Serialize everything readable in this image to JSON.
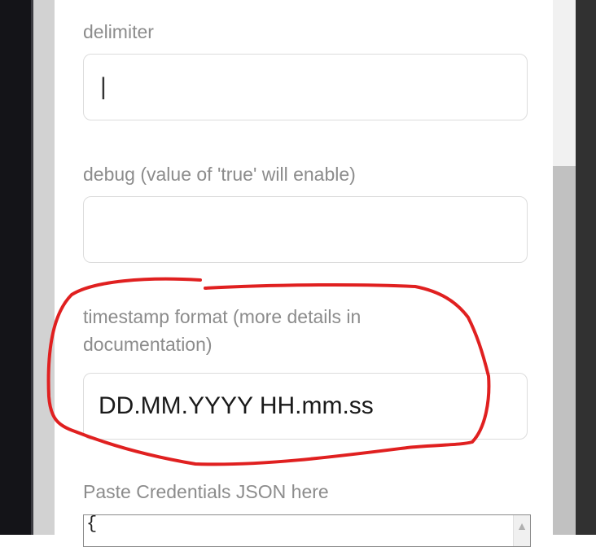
{
  "form": {
    "delimiter": {
      "label": "delimiter",
      "value": "|"
    },
    "debug": {
      "label": "debug (value of 'true' will enable)",
      "value": ""
    },
    "timestamp_format": {
      "label": "timestamp format (more details in documentation)",
      "value": "DD.MM.YYYY HH.mm.ss"
    },
    "credentials": {
      "label": "Paste Credentials JSON here",
      "value": "{"
    }
  },
  "annotation": {
    "color": "#e02020",
    "shape": "hand-drawn-ellipse"
  },
  "colors": {
    "label_text": "#8c8c8c",
    "input_border": "#dcdcdc",
    "scrollbar_thumb": "#c1c1c1"
  }
}
